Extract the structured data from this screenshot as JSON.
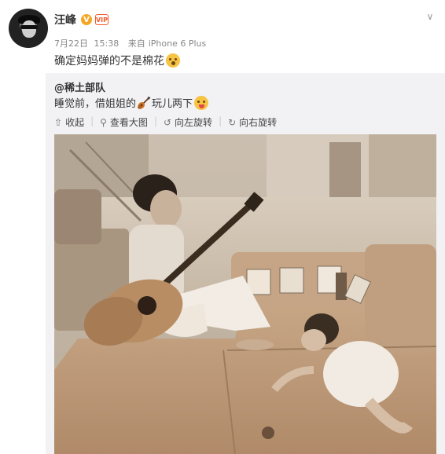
{
  "post": {
    "username": "汪峰",
    "verified_badge": "V",
    "member_badge": "VIP",
    "date": "7月22日",
    "time": "15:38",
    "source_prefix": "来自",
    "source": "iPhone 6 Plus",
    "text": "确定妈妈弹的不是棉花",
    "emoji": "yawn-emoji"
  },
  "repost": {
    "author": "@稀土部队",
    "text_before": "睡觉前，借姐姐的",
    "text_after": "玩儿两下",
    "emoji_1": "guitar-emoji",
    "emoji_2": "tongue-out-emoji",
    "actions": [
      {
        "label": "收起",
        "icon": "collapse-arrow-icon"
      },
      {
        "label": "查看大图",
        "icon": "magnifier-icon"
      },
      {
        "label": "向左旋转",
        "icon": "rotate-left-icon"
      },
      {
        "label": "向右旋转",
        "icon": "rotate-right-icon"
      }
    ]
  },
  "colors": {
    "accent_orange": "#f5a623",
    "link_text": "#333333",
    "meta_gray": "#888888",
    "repost_bg": "#f2f2f5"
  }
}
